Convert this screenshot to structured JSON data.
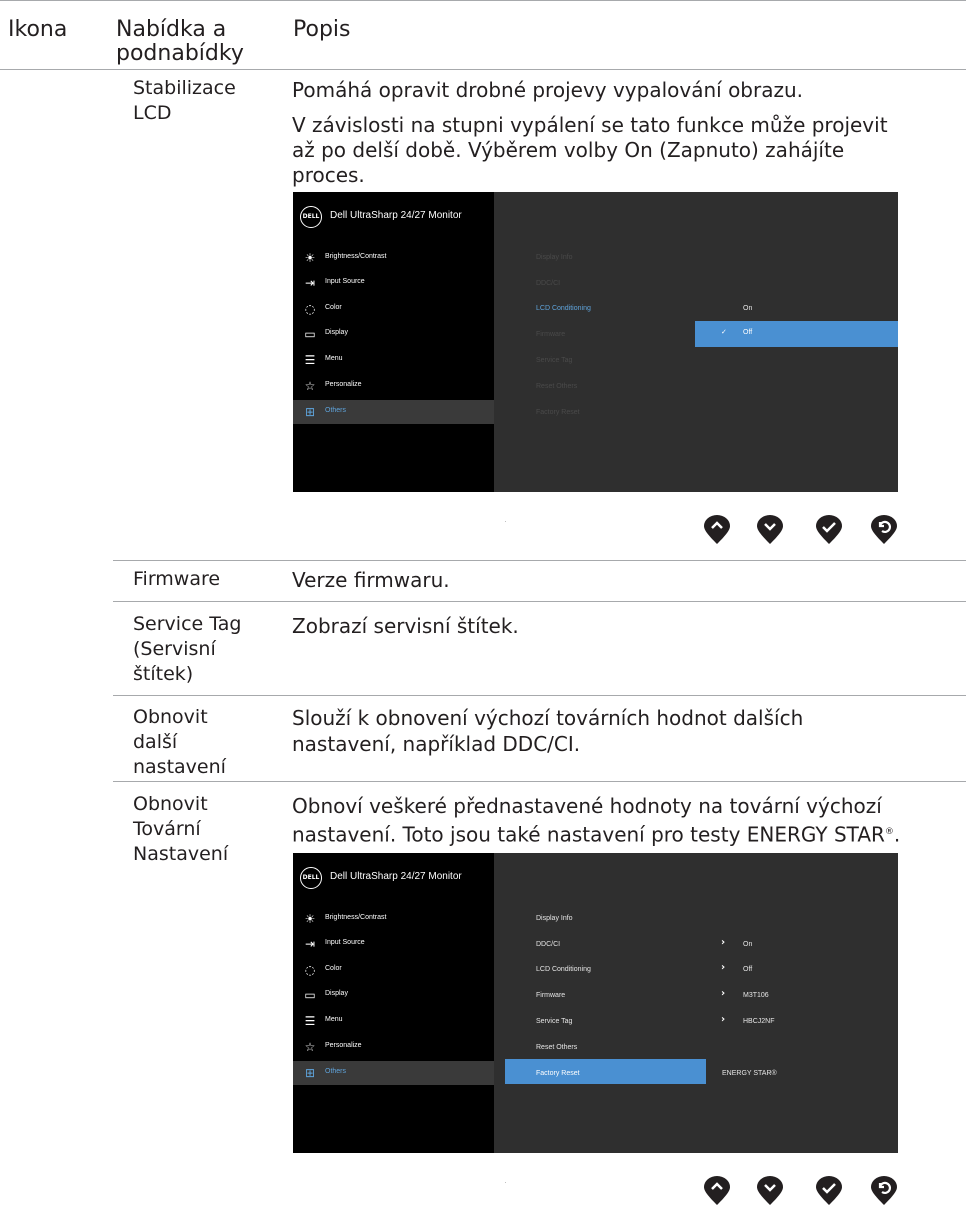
{
  "headers": {
    "icon": "Ikona",
    "menu_line1": "Nabídka a",
    "menu_line2": "podnabídky",
    "description": "Popis"
  },
  "rows": {
    "lcd": {
      "name_line1": "Stabilizace",
      "name_line2": "LCD",
      "desc1": "Pomáhá opravit drobné projevy vypalování obrazu.",
      "desc2_line1": "V závislosti na stupni vypálení se tato funkce může projevit",
      "desc2_line2": "až po delší době. Výběrem volby On (Zapnuto) zahájíte",
      "desc2_line3": "proces."
    },
    "firmware": {
      "name": "Firmware",
      "desc": "Verze firmwaru."
    },
    "service_tag": {
      "name_line1": "Service Tag",
      "name_line2": "(Servisní",
      "name_line3": "štítek)",
      "desc": "Zobrazí servisní štítek."
    },
    "reset_others": {
      "name_line1": "Obnovit",
      "name_line2": "další",
      "name_line3": "nastavení",
      "desc_line1": "Slouží k obnovení výchozí továrních hodnot dalších",
      "desc_line2": "nastavení, například DDC/CI."
    },
    "factory_reset": {
      "name_line1": "Obnovit",
      "name_line2": "Tovární",
      "name_line3": "Nastavení",
      "desc_line1": "Obnoví veškeré přednastavené hodnoty na tovární výchozí",
      "desc_line2": "nastavení. Toto jsou také nastavení pro testy ENERGY STAR",
      "desc_reg": "®",
      "desc_end": "."
    }
  },
  "osd": {
    "logo": "DELL",
    "title": "Dell UltraSharp 24/27 Monitor",
    "menu": [
      "Brightness/Contrast",
      "Input Source",
      "Color",
      "Display",
      "Menu",
      "Personalize",
      "Others"
    ],
    "icons": [
      "brightness-icon",
      "input-source-icon",
      "color-icon",
      "display-icon",
      "menu-icon",
      "personalize-icon",
      "others-icon"
    ],
    "others_items": [
      "Display Info",
      "DDC/CI",
      "LCD Conditioning",
      "Firmware",
      "Service Tag",
      "Reset Others",
      "Factory Reset"
    ],
    "osd1": {
      "option_on": "On",
      "option_off": "Off",
      "check": "✓"
    },
    "osd2": {
      "values": {
        "ddc": "On",
        "lcd": "Off",
        "firmware": "M3T106",
        "service_tag": "HBCJ2NF"
      },
      "energy_star": "ENERGY STAR®"
    },
    "colors": {
      "background": "#2f2f2f",
      "menu_background": "#000000",
      "accent": "#4a90d2",
      "selected_text": "#5fa4dc"
    }
  },
  "controls": [
    "up-button",
    "down-button",
    "ok-button",
    "back-button"
  ]
}
